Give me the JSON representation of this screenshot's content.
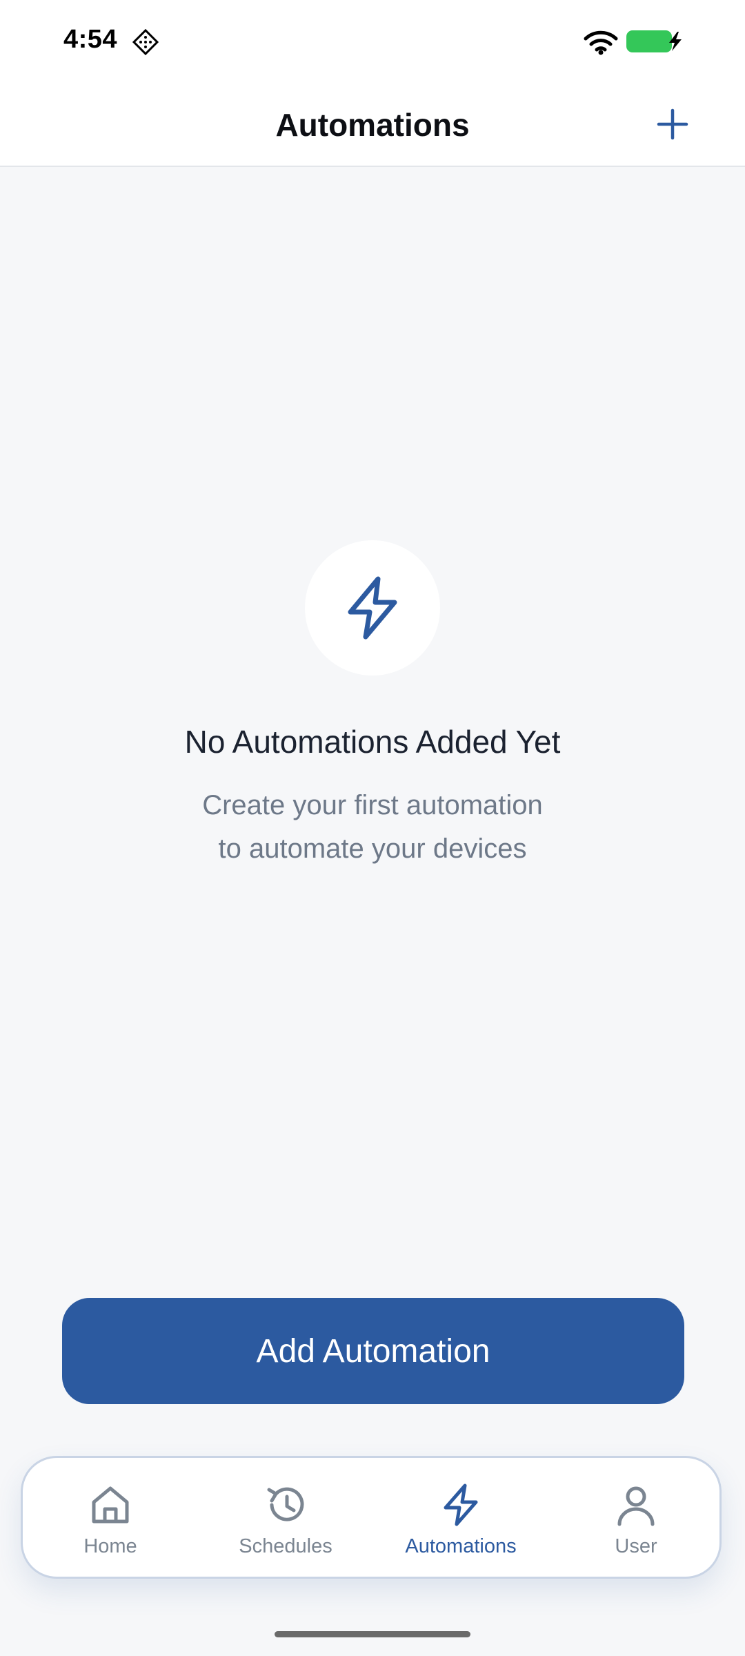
{
  "status_bar": {
    "time": "4:54"
  },
  "header": {
    "title": "Automations",
    "add_icon": "plus-icon"
  },
  "empty_state": {
    "icon": "lightning-bolt-icon",
    "title": "No Automations Added Yet",
    "subtitle_line1": "Create your first automation",
    "subtitle_line2": "to automate your devices"
  },
  "primary_action": {
    "label": "Add Automation"
  },
  "bottom_nav": {
    "items": [
      {
        "label": "Home",
        "icon": "home-icon",
        "active": false
      },
      {
        "label": "Schedules",
        "icon": "history-icon",
        "active": false
      },
      {
        "label": "Automations",
        "icon": "lightning-bolt-icon",
        "active": true
      },
      {
        "label": "User",
        "icon": "user-icon",
        "active": false
      }
    ]
  },
  "colors": {
    "accent": "#2c5aa0",
    "background": "#f6f7f9",
    "inactive": "#7b8591",
    "battery": "#34c759"
  }
}
